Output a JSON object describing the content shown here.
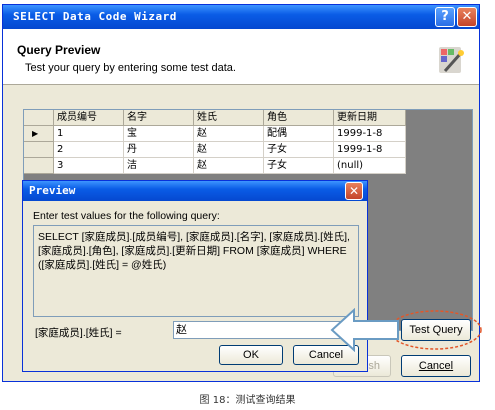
{
  "window": {
    "title": "SELECT Data Code Wizard",
    "help_glyph": "?",
    "close_glyph": "✕"
  },
  "header": {
    "title": "Query Preview",
    "subtitle": "Test your query by entering some test data."
  },
  "grid": {
    "columns": [
      "成员编号",
      "名字",
      "姓氏",
      "角色",
      "更新日期"
    ],
    "current_row_marker": "▶",
    "rows": [
      [
        "1",
        "宝",
        "赵",
        "配偶",
        "1999-1-8"
      ],
      [
        "2",
        "丹",
        "赵",
        "子女",
        "1999-1-8"
      ],
      [
        "3",
        "洁",
        "赵",
        "子女",
        "(null)"
      ]
    ]
  },
  "buttons": {
    "test_query": "Test Query",
    "finish_partial": "sh",
    "cancel": "Cancel"
  },
  "preview": {
    "title": "Preview",
    "close_glyph": "✕",
    "instruction": "Enter test values for the following query:",
    "query_text": "SELECT [家庭成员].[成员编号], [家庭成员].[名字], [家庭成员].[姓氏], [家庭成员].[角色], [家庭成员].[更新日期] FROM [家庭成员] WHERE ([家庭成员].[姓氏] = @姓氏)",
    "param_label": "[家庭成员].[姓氏] =",
    "param_value": "赵",
    "ok": "OK",
    "cancel": "Cancel"
  },
  "caption": "图 18：测试查询结果",
  "colors": {
    "title_bar": "#0a5ce6",
    "window_bg": "#ece9d8",
    "annotation_arrow": "#6a9bc3",
    "annotation_ellipse": "#e2572a"
  }
}
